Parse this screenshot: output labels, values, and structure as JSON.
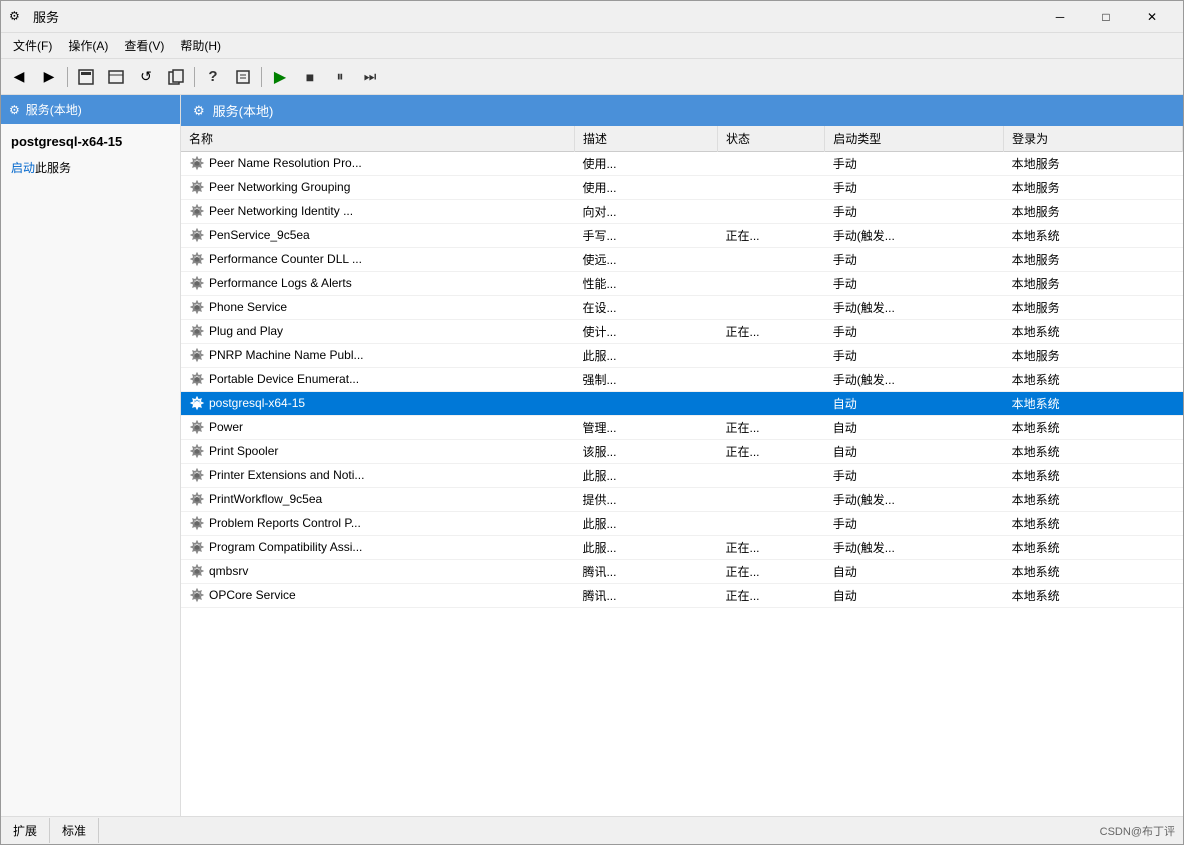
{
  "window": {
    "title": "服务",
    "icon": "⚙"
  },
  "titleControls": {
    "minimize": "─",
    "maximize": "□",
    "close": "✕"
  },
  "menuBar": {
    "items": [
      {
        "id": "file",
        "label": "文件(F)"
      },
      {
        "id": "action",
        "label": "操作(A)"
      },
      {
        "id": "view",
        "label": "查看(V)"
      },
      {
        "id": "help",
        "label": "帮助(H)"
      }
    ]
  },
  "sidebar": {
    "header": "服务(本地)",
    "serviceName": "postgresql-x64-15",
    "startLink": "启动",
    "startLinkSuffix": "此服务"
  },
  "contentHeader": "服务(本地)",
  "table": {
    "columns": [
      {
        "id": "name",
        "label": "名称"
      },
      {
        "id": "desc",
        "label": "描述"
      },
      {
        "id": "status",
        "label": "状态"
      },
      {
        "id": "startup",
        "label": "启动类型"
      },
      {
        "id": "login",
        "label": "登录为"
      }
    ],
    "rows": [
      {
        "name": "Peer Name Resolution Pro...",
        "desc": "使用...",
        "status": "",
        "startup": "手动",
        "login": "本地服务",
        "selected": false
      },
      {
        "name": "Peer Networking Grouping",
        "desc": "使用...",
        "status": "",
        "startup": "手动",
        "login": "本地服务",
        "selected": false
      },
      {
        "name": "Peer Networking Identity ...",
        "desc": "向对...",
        "status": "",
        "startup": "手动",
        "login": "本地服务",
        "selected": false
      },
      {
        "name": "PenService_9c5ea",
        "desc": "手写...",
        "status": "正在...",
        "startup": "手动(触发...",
        "login": "本地系统",
        "selected": false
      },
      {
        "name": "Performance Counter DLL ...",
        "desc": "使远...",
        "status": "",
        "startup": "手动",
        "login": "本地服务",
        "selected": false
      },
      {
        "name": "Performance Logs & Alerts",
        "desc": "性能...",
        "status": "",
        "startup": "手动",
        "login": "本地服务",
        "selected": false
      },
      {
        "name": "Phone Service",
        "desc": "在设...",
        "status": "",
        "startup": "手动(触发...",
        "login": "本地服务",
        "selected": false
      },
      {
        "name": "Plug and Play",
        "desc": "使计...",
        "status": "正在...",
        "startup": "手动",
        "login": "本地系统",
        "selected": false
      },
      {
        "name": "PNRP Machine Name Publ...",
        "desc": "此服...",
        "status": "",
        "startup": "手动",
        "login": "本地服务",
        "selected": false
      },
      {
        "name": "Portable Device Enumerat...",
        "desc": "强制...",
        "status": "",
        "startup": "手动(触发...",
        "login": "本地系统",
        "selected": false
      },
      {
        "name": "postgresql-x64-15",
        "desc": "",
        "status": "",
        "startup": "自动",
        "login": "本地系统",
        "selected": true
      },
      {
        "name": "Power",
        "desc": "管理...",
        "status": "正在...",
        "startup": "自动",
        "login": "本地系统",
        "selected": false
      },
      {
        "name": "Print Spooler",
        "desc": "该服...",
        "status": "正在...",
        "startup": "自动",
        "login": "本地系统",
        "selected": false
      },
      {
        "name": "Printer Extensions and Noti...",
        "desc": "此服...",
        "status": "",
        "startup": "手动",
        "login": "本地系统",
        "selected": false
      },
      {
        "name": "PrintWorkflow_9c5ea",
        "desc": "提供...",
        "status": "",
        "startup": "手动(触发...",
        "login": "本地系统",
        "selected": false
      },
      {
        "name": "Problem Reports Control P...",
        "desc": "此服...",
        "status": "",
        "startup": "手动",
        "login": "本地系统",
        "selected": false
      },
      {
        "name": "Program Compatibility Assi...",
        "desc": "此服...",
        "status": "正在...",
        "startup": "手动(触发...",
        "login": "本地系统",
        "selected": false
      },
      {
        "name": "qmbsrv",
        "desc": "腾讯...",
        "status": "正在...",
        "startup": "自动",
        "login": "本地系统",
        "selected": false
      },
      {
        "name": "OPCore Service",
        "desc": "腾讯...",
        "status": "正在...",
        "startup": "自动",
        "login": "本地系统",
        "selected": false
      }
    ]
  },
  "statusBar": {
    "tabs": [
      "扩展",
      "标准"
    ],
    "watermark": "CSDN@布丁评"
  }
}
